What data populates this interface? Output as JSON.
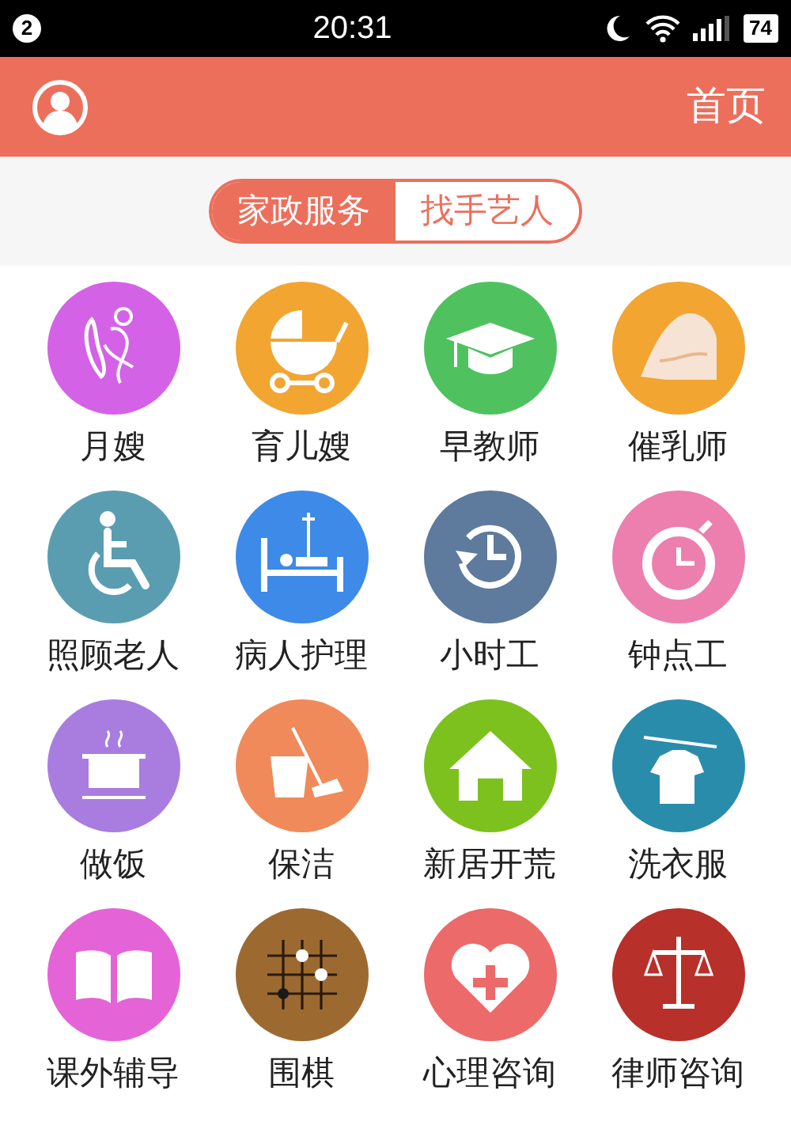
{
  "status_bar": {
    "notification_count": "2",
    "time": "20:31",
    "battery": "74"
  },
  "header": {
    "title": "首页"
  },
  "tabs": [
    {
      "label": "家政服务",
      "selected": true
    },
    {
      "label": "找手艺人",
      "selected": false
    }
  ],
  "services": [
    {
      "label": "月嫂",
      "color": "#d462e6"
    },
    {
      "label": "育儿嫂",
      "color": "#f2a530"
    },
    {
      "label": "早教师",
      "color": "#4fc25f"
    },
    {
      "label": "催乳师",
      "color": "#f2a530"
    },
    {
      "label": "照顾老人",
      "color": "#5b9db0"
    },
    {
      "label": "病人护理",
      "color": "#3d8ae8"
    },
    {
      "label": "小时工",
      "color": "#5e7a9c"
    },
    {
      "label": "钟点工",
      "color": "#ec7fae"
    },
    {
      "label": "做饭",
      "color": "#a97ddf"
    },
    {
      "label": "保洁",
      "color": "#f08a5a"
    },
    {
      "label": "新居开荒",
      "color": "#7cc11e"
    },
    {
      "label": "洗衣服",
      "color": "#2a8cab"
    },
    {
      "label": "课外辅导",
      "color": "#e463d6"
    },
    {
      "label": "围棋",
      "color": "#9c6a30"
    },
    {
      "label": "心理咨询",
      "color": "#ec6a6a"
    },
    {
      "label": "律师咨询",
      "color": "#b8302a"
    }
  ]
}
